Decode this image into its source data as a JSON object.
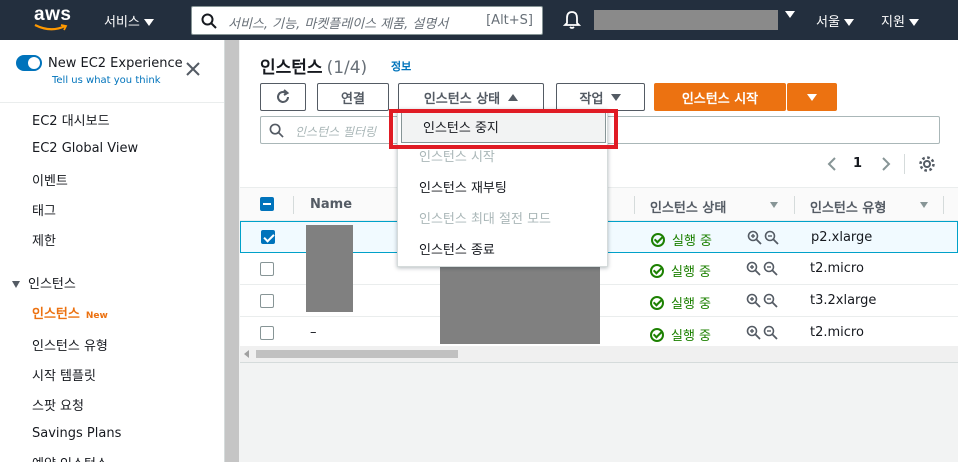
{
  "topnav": {
    "logo_text": "aws",
    "services": "서비스",
    "search_placeholder": "서비스, 기능, 마켓플레이스 제품, 설명서",
    "search_shortcut": "[Alt+S]",
    "region": "서울",
    "support": "지원"
  },
  "sidebar": {
    "experience_title": "New EC2 Experience",
    "experience_link": "Tell us what you think",
    "items": [
      {
        "label": "EC2 대시보드"
      },
      {
        "label": "EC2 Global View"
      },
      {
        "label": "이벤트"
      },
      {
        "label": "태그"
      },
      {
        "label": "제한"
      }
    ],
    "section": "인스턴스",
    "sub_items": [
      {
        "label": "인스턴스",
        "badge": "New"
      },
      {
        "label": "인스턴스 유형"
      },
      {
        "label": "시작 템플릿"
      },
      {
        "label": "스팟 요청"
      },
      {
        "label": "Savings Plans"
      },
      {
        "label": "예약 인스턴스"
      }
    ]
  },
  "main": {
    "title": "인스턴스",
    "count": "(1/4)",
    "info": "정보",
    "buttons": {
      "connect": "연결",
      "instance_state": "인스턴스 상태",
      "actions": "작업",
      "launch": "인스턴스 시작"
    },
    "filter_placeholder": "인스턴스 필터링",
    "page": "1",
    "columns": {
      "name": "Name",
      "state": "인스턴스 상태",
      "type": "인스턴스 유형"
    },
    "rows": [
      {
        "name": "",
        "state": "실행 중",
        "type": "p2.xlarge",
        "selected": true
      },
      {
        "name": "",
        "state": "실행 중",
        "type": "t2.micro",
        "selected": false
      },
      {
        "name": "",
        "state": "실행 중",
        "type": "t3.2xlarge",
        "selected": false
      },
      {
        "name": "–",
        "state": "실행 중",
        "type": "t2.micro",
        "selected": false
      }
    ]
  },
  "dropdown": {
    "items": [
      {
        "label": "인스턴스 중지",
        "enabled": true
      },
      {
        "label": "인스턴스 시작",
        "enabled": false
      },
      {
        "label": "인스턴스 재부팅",
        "enabled": true
      },
      {
        "label": "인스턴스 최대 절전 모드",
        "enabled": false
      },
      {
        "label": "인스턴스 종료",
        "enabled": true
      }
    ]
  },
  "colors": {
    "nav_bg": "#232f3e",
    "accent_orange": "#ec7211",
    "link_blue": "#0073bb",
    "running_green": "#1d8102",
    "highlight_red": "#e01b24"
  }
}
